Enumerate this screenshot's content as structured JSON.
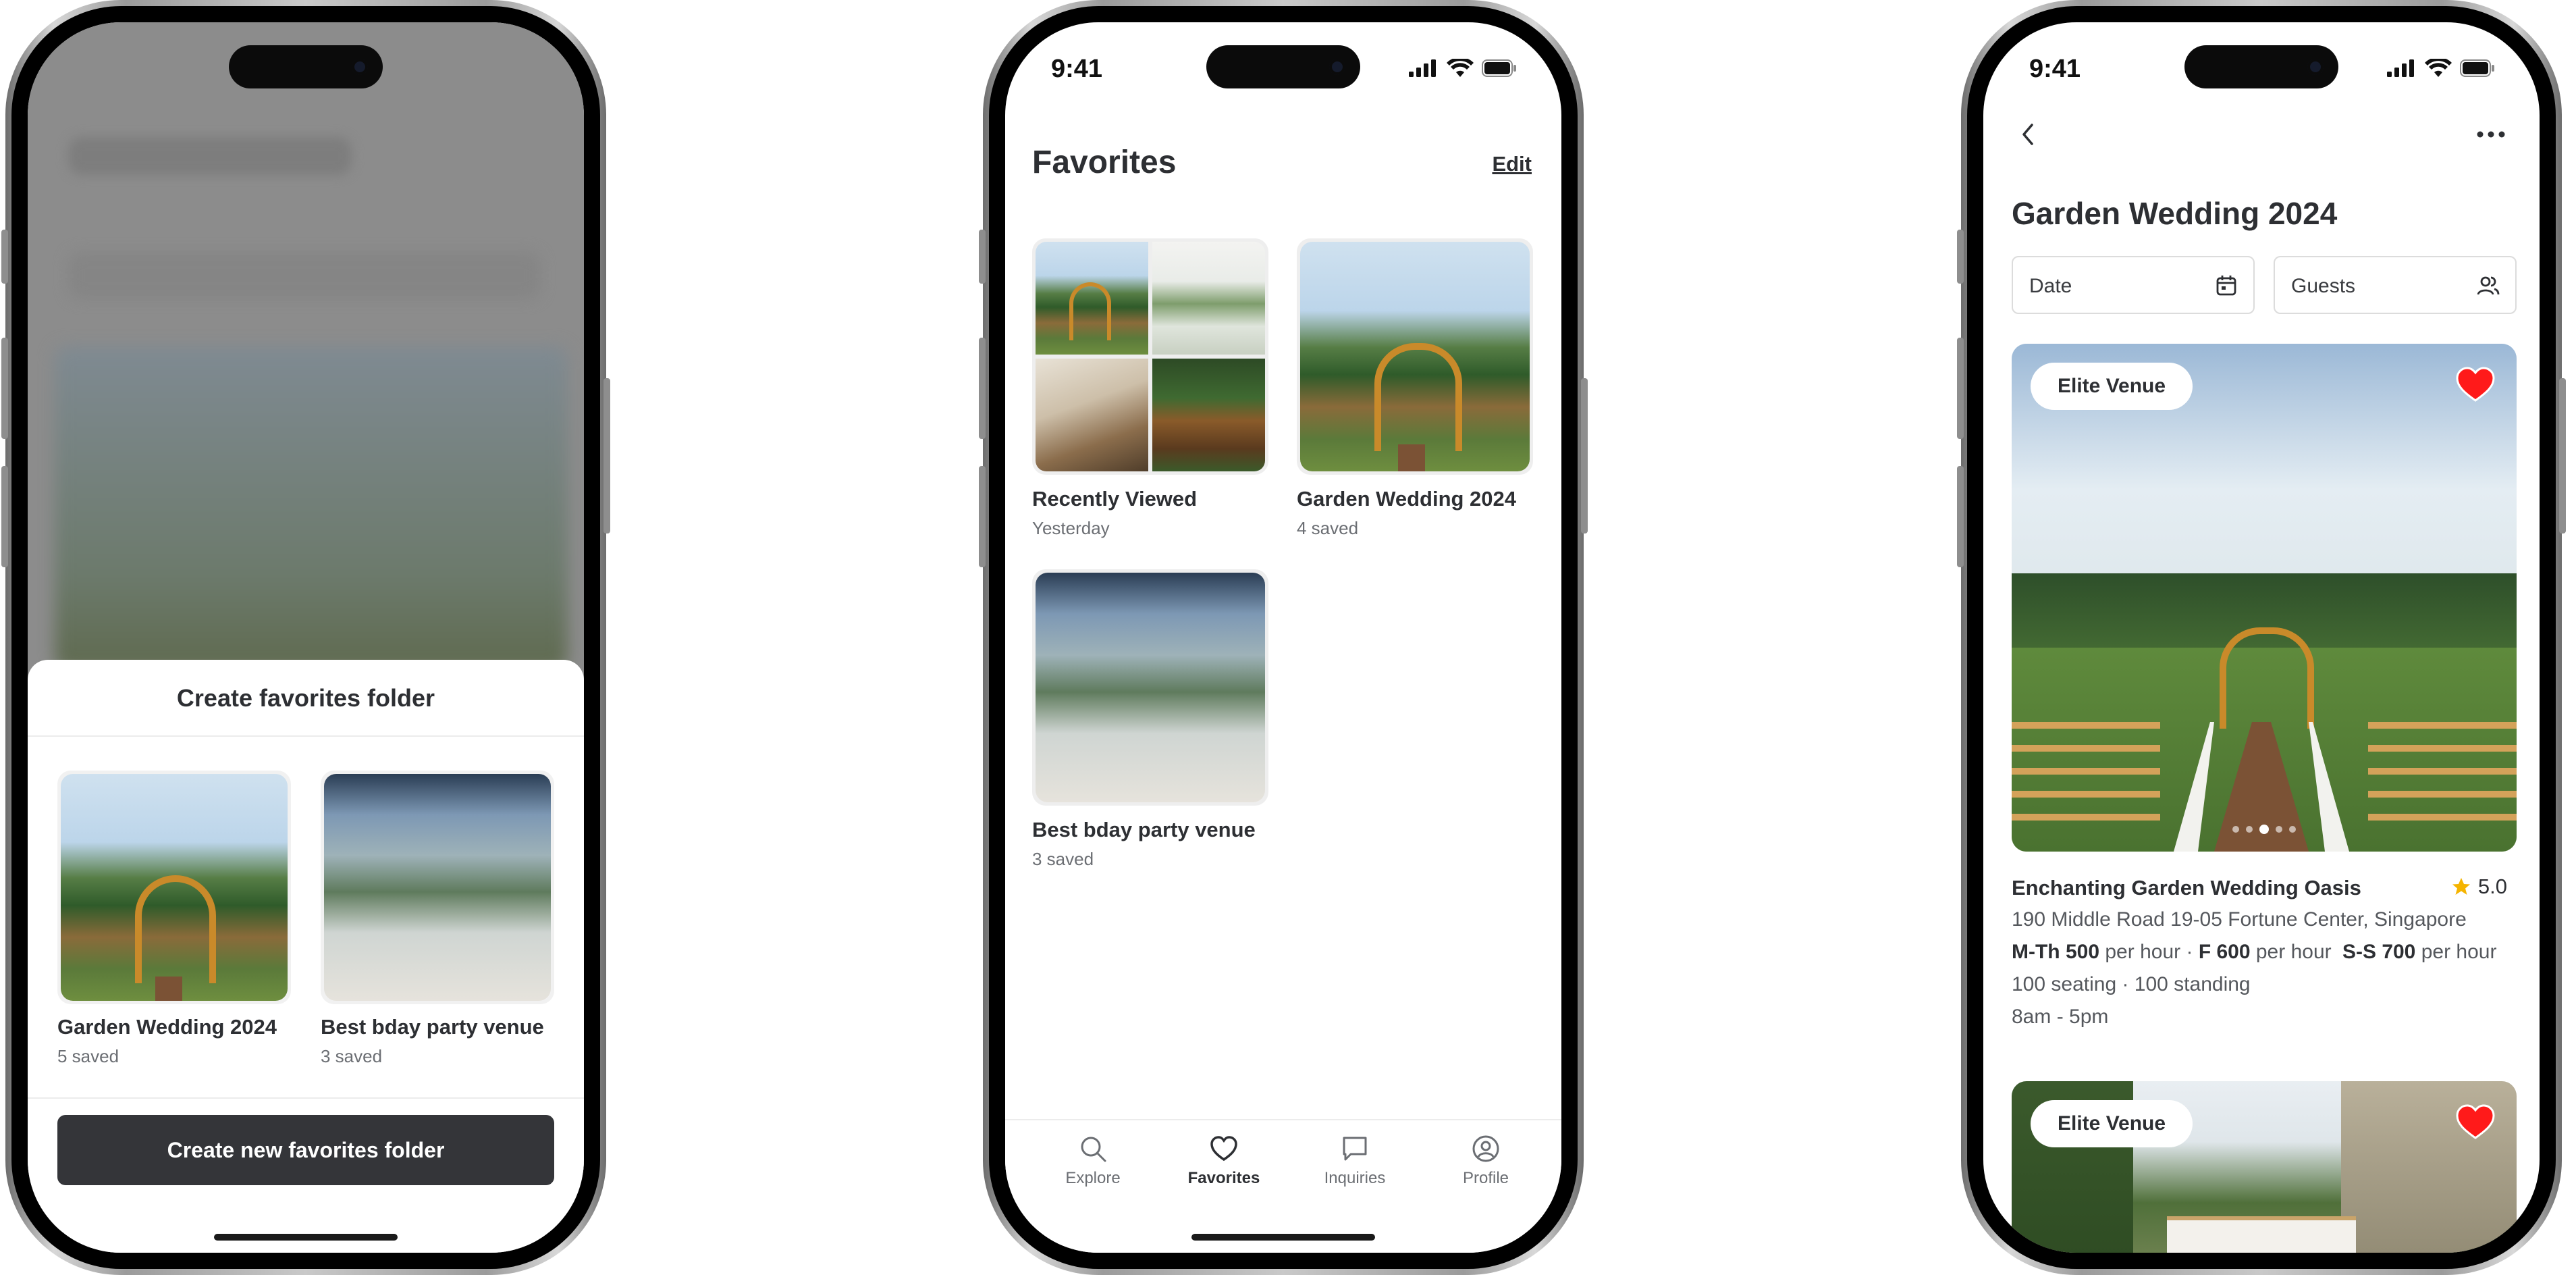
{
  "status": {
    "time": "9:41"
  },
  "phone1": {
    "sheet_title": "Create favorites folder",
    "folders": [
      {
        "name": "Garden Wedding 2024",
        "sub": "5 saved"
      },
      {
        "name": "Best bday party venue",
        "sub": "3 saved"
      }
    ],
    "create_button": "Create new favorites folder"
  },
  "phone2": {
    "title": "Favorites",
    "edit": "Edit",
    "folders": [
      {
        "name": "Recently Viewed",
        "sub": "Yesterday"
      },
      {
        "name": "Garden Wedding 2024",
        "sub": "4 saved"
      },
      {
        "name": "Best bday party venue",
        "sub": "3 saved"
      }
    ],
    "tabs": [
      {
        "label": "Explore",
        "icon": "search-icon"
      },
      {
        "label": "Favorites",
        "icon": "heart-icon"
      },
      {
        "label": "Inquiries",
        "icon": "chat-icon"
      },
      {
        "label": "Profile",
        "icon": "profile-icon"
      }
    ],
    "active_tab": "Favorites"
  },
  "phone3": {
    "title": "Garden Wedding 2024",
    "filters": {
      "date": "Date",
      "guests": "Guests"
    },
    "venues": [
      {
        "badge": "Elite Venue",
        "name": "Enchanting Garden Wedding Oasis",
        "rating": "5.0",
        "address": "190 Middle Road 19-05 Fortune Center, Singapore",
        "pricing": [
          {
            "days": "M-Th 500",
            "unit": "per hour"
          },
          {
            "days": "F 600",
            "unit": "per hour"
          },
          {
            "days": "S-S 700",
            "unit": "per hour"
          }
        ],
        "capacity": "100 seating · 100 standing",
        "hours": "8am - 5pm"
      },
      {
        "badge": "Elite Venue"
      }
    ]
  },
  "colors": {
    "accent_dark": "#343539",
    "heart_red": "#ff1a1a",
    "star": "#f5b400"
  }
}
